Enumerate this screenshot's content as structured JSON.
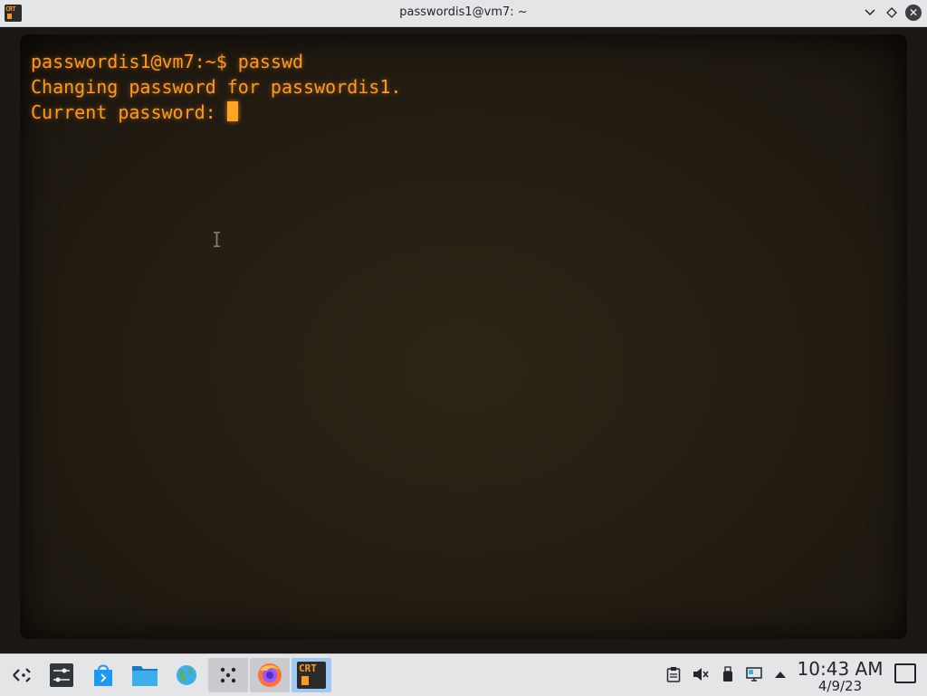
{
  "window": {
    "title": "passwordis1@vm7: ~",
    "app_icon_text": "CRT"
  },
  "terminal": {
    "lines": [
      "passwordis1@vm7:~$ passwd",
      "Changing password for passwordis1.",
      "Current password: "
    ],
    "text_color": "#ff9a20"
  },
  "taskbar": {
    "launcher_icon": "application-launcher-icon",
    "tasks": [
      {
        "name": "system-settings",
        "icon": "settings-sliders-icon"
      },
      {
        "name": "discover",
        "icon": "discover-store-icon"
      },
      {
        "name": "dolphin",
        "icon": "folder-icon"
      },
      {
        "name": "web-browser",
        "icon": "globe-icon"
      },
      {
        "name": "dice-app",
        "icon": "dice-icon"
      },
      {
        "name": "firefox",
        "icon": "firefox-icon"
      },
      {
        "name": "cool-retro-term",
        "icon": "crt-terminal-icon",
        "label": "CRT"
      }
    ],
    "tray": [
      "clipboard-icon",
      "volume-muted-icon",
      "usb-device-icon",
      "network-icon",
      "expand-tray-icon"
    ],
    "clock": {
      "time": "10:43 AM",
      "date": "4/9/23"
    },
    "accent": "#3daee9"
  }
}
